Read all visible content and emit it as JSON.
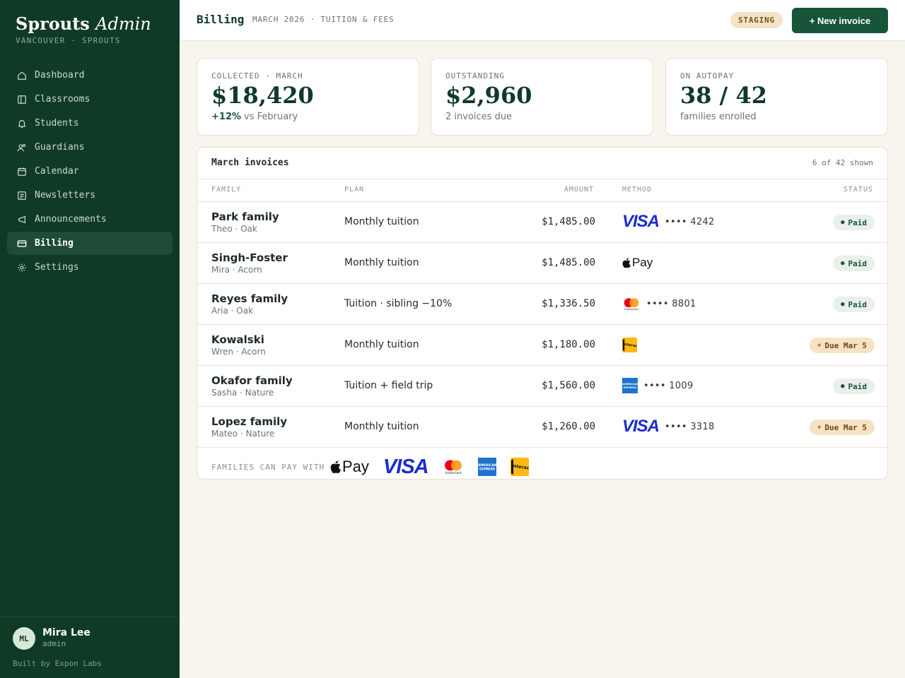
{
  "sidebar": {
    "brand_bold": "Sprouts",
    "brand_italic": "Admin",
    "brand_sub": "VANCOUVER · SPROUTS",
    "items": [
      {
        "label": "Dashboard",
        "icon": "home-icon"
      },
      {
        "label": "Classrooms",
        "icon": "columns-icon"
      },
      {
        "label": "Students",
        "icon": "bell-icon"
      },
      {
        "label": "Guardians",
        "icon": "users-icon"
      },
      {
        "label": "Calendar",
        "icon": "calendar-icon"
      },
      {
        "label": "Newsletters",
        "icon": "newsletter-icon"
      },
      {
        "label": "Announcements",
        "icon": "megaphone-icon"
      },
      {
        "label": "Billing",
        "icon": "credit-card-icon",
        "active": true
      },
      {
        "label": "Settings",
        "icon": "gear-icon"
      }
    ],
    "user": {
      "initials": "ML",
      "name": "Mira Lee",
      "role": "admin"
    },
    "built_by": "Built by Expon Labs"
  },
  "header": {
    "title": "Billing",
    "subtitle": "MARCH 2026 · TUITION & FEES",
    "env_badge": "STAGING",
    "new_invoice": "+ New invoice"
  },
  "stats": [
    {
      "label": "COLLECTED · MARCH",
      "value": "$18,420",
      "note_highlight": "+12%",
      "note": "vs February"
    },
    {
      "label": "OUTSTANDING",
      "value": "$2,960",
      "note": "2 invoices due"
    },
    {
      "label": "ON AUTOPAY",
      "value": "38 / 42",
      "note": "families enrolled"
    }
  ],
  "invoices": {
    "title": "March invoices",
    "count": "6 of 42 shown",
    "columns": {
      "family": "FAMILY",
      "plan": "PLAN",
      "amount": "AMOUNT",
      "method": "METHOD",
      "status": "STATUS"
    },
    "rows": [
      {
        "family": "Park family",
        "child": "Theo · Oak",
        "plan": "Monthly tuition",
        "amount": "$1,485.00",
        "method": "visa",
        "last4": "•••• 4242",
        "status": "Paid",
        "status_kind": "paid"
      },
      {
        "family": "Singh-Foster",
        "child": "Mira · Acorn",
        "plan": "Monthly tuition",
        "amount": "$1,485.00",
        "method": "apple-pay",
        "last4": "",
        "status": "Paid",
        "status_kind": "paid"
      },
      {
        "family": "Reyes family",
        "child": "Aria · Oak",
        "plan": "Tuition · sibling −10%",
        "amount": "$1,336.50",
        "method": "mastercard",
        "last4": "•••• 8801",
        "status": "Paid",
        "status_kind": "paid"
      },
      {
        "family": "Kowalski",
        "child": "Wren · Acorn",
        "plan": "Monthly tuition",
        "amount": "$1,180.00",
        "method": "interac",
        "last4": "",
        "status": "Due Mar 5",
        "status_kind": "due"
      },
      {
        "family": "Okafor family",
        "child": "Sasha · Nature",
        "plan": "Tuition + field trip",
        "amount": "$1,560.00",
        "method": "amex",
        "last4": "•••• 1009",
        "status": "Paid",
        "status_kind": "paid"
      },
      {
        "family": "Lopez family",
        "child": "Mateo · Nature",
        "plan": "Monthly tuition",
        "amount": "$1,260.00",
        "method": "visa",
        "last4": "•••• 3318",
        "status": "Due Mar 5",
        "status_kind": "due"
      }
    ],
    "pay_with_label": "FAMILIES CAN PAY WITH",
    "pay_methods": [
      "apple-pay",
      "visa",
      "mastercard",
      "amex",
      "interac"
    ]
  },
  "logos": {
    "visa": "VISA",
    "apple_pay": "Pay",
    "mastercard": "mastercard",
    "amex_top": "AMERICAN",
    "amex_bottom": "EXPRESS",
    "interac": "Interac"
  },
  "colors": {
    "sidebar": "#0f3a26",
    "accent": "#17553a",
    "paid": "#17553a",
    "due": "#c0832e",
    "visa": "#1a2ccf",
    "amex": "#1f72cd",
    "interac": "#fdb913"
  }
}
